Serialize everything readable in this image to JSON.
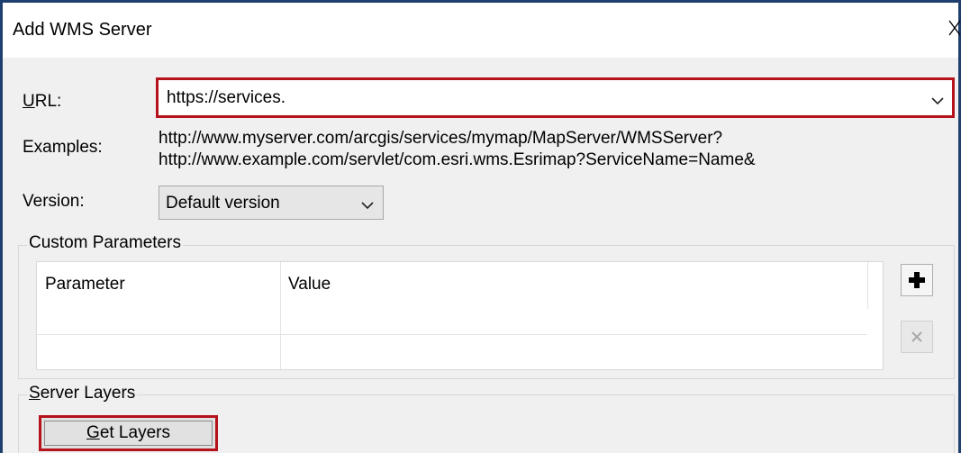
{
  "window": {
    "title": "Add WMS Server",
    "close_icon": "close-icon"
  },
  "url": {
    "label": "URL:",
    "value": "https://services.",
    "dropdown_icon": "chevron-down-icon"
  },
  "examples": {
    "label": "Examples:",
    "lines": [
      "http://www.myserver.com/arcgis/services/mymap/MapServer/WMSServer?",
      "http://www.example.com/servlet/com.esri.wms.Esrimap?ServiceName=Name&"
    ]
  },
  "version": {
    "label": "Version:",
    "selected": "Default version",
    "dropdown_icon": "chevron-down-icon"
  },
  "custom_parameters": {
    "legend": "Custom Parameters",
    "columns": [
      "Parameter",
      "Value"
    ],
    "add_icon": "plus-icon",
    "delete_icon": "x-icon"
  },
  "server_layers": {
    "legend": "Server Layers",
    "get_layers_label": "Get Layers"
  },
  "colors": {
    "highlight_border": "#b5121b",
    "window_frame": "#1f3f6e"
  }
}
